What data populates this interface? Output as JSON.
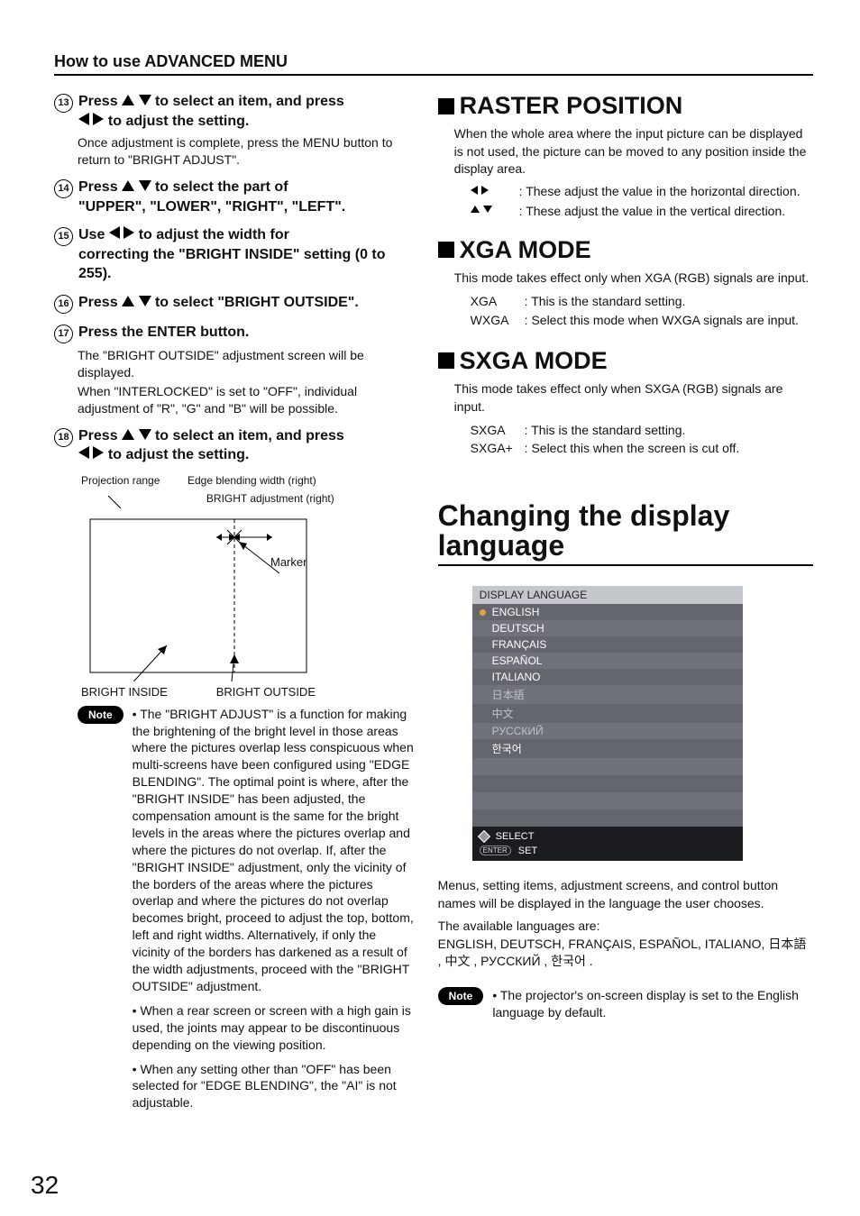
{
  "pageNumber": "32",
  "header": "How to use ADVANCED MENU",
  "left": {
    "step13": {
      "n": "13",
      "textA": "Press",
      "textB": "to select an item, and press",
      "textC": "to adjust the setting.",
      "body": "Once adjustment is complete, press the MENU button to return to \"BRIGHT ADJUST\"."
    },
    "step14": {
      "n": "14",
      "textA": "Press",
      "textB": "to select the part of",
      "textC": "\"UPPER\", \"LOWER\", \"RIGHT\", \"LEFT\"."
    },
    "step15": {
      "n": "15",
      "textA": "Use",
      "textB": "to adjust the width for",
      "textC": "correcting the \"BRIGHT INSIDE\" setting (0 to 255)."
    },
    "step16": {
      "n": "16",
      "textA": "Press",
      "textB": "to select \"BRIGHT OUTSIDE\"."
    },
    "step17": {
      "n": "17",
      "textA": "Press the ENTER button.",
      "body1": "The \"BRIGHT OUTSIDE\" adjustment screen will be displayed.",
      "body2": "When \"INTERLOCKED\" is set to \"OFF\", individual adjustment of \"R\", \"G\" and \"B\" will be possible."
    },
    "step18": {
      "n": "18",
      "textA": "Press",
      "textB": "to select an item, and press",
      "textC": "to adjust the setting."
    },
    "diagram": {
      "projRange": "Projection range",
      "edgeWidth": "Edge blending width (right)",
      "brightAdj": "BRIGHT adjustment (right)",
      "marker": "Marker",
      "inside": "BRIGHT INSIDE",
      "outside": "BRIGHT OUTSIDE"
    },
    "noteLabel": "Note",
    "note1": "• The \"BRIGHT ADJUST\" is a function for making the brightening of the bright level in those areas where the pictures overlap less conspicuous when multi-screens have been configured using \"EDGE BLENDING\". The optimal point is where, after the \"BRIGHT INSIDE\" has been adjusted, the compensation amount is the same for the bright levels in the areas where the pictures overlap and where the pictures do not overlap. If, after the \"BRIGHT INSIDE\" adjustment, only the vicinity of the borders of the areas where the pictures overlap and where the pictures do not overlap becomes bright, proceed to adjust the top, bottom, left and right widths. Alternatively, if only the vicinity of the borders has darkened as a result of the width adjustments, proceed with the \"BRIGHT OUTSIDE\" adjustment.",
    "note2": "• When a rear screen or screen with a high gain is used, the joints may appear to be discontinuous depending on the viewing position.",
    "note3": "• When any setting other than \"OFF\" has been selected for \"EDGE BLENDING\", the \"AI\" is not adjustable."
  },
  "right": {
    "raster": {
      "title": "RASTER POSITION",
      "para": "When the whole area where the input picture can be displayed is not used, the picture can be moved to any position inside the display area.",
      "h": ": These adjust the value in the horizontal direction.",
      "v": ": These adjust the value in the vertical direction."
    },
    "xga": {
      "title": "XGA MODE",
      "para": "This mode takes effect only when XGA (RGB) signals are input.",
      "k1": "XGA",
      "v1": ": This is the standard setting.",
      "k2": "WXGA",
      "v2": ": Select this mode when WXGA signals are input."
    },
    "sxga": {
      "title": "SXGA MODE",
      "para": "This mode takes effect only when SXGA (RGB) signals are input.",
      "k1": "SXGA",
      "v1": ": This is the standard setting.",
      "k2": "SXGA+",
      "v2": ": Select this when the screen is cut off."
    },
    "lang": {
      "title": "Changing the display language",
      "menuHead": "DISPLAY LANGUAGE",
      "items": [
        "ENGLISH",
        "DEUTSCH",
        "FRANÇAIS",
        "ESPAÑOL",
        "ITALIANO",
        "日本語",
        "中文",
        "РУССКИЙ",
        "한국어"
      ],
      "footSelect": "SELECT",
      "footSet": "SET",
      "para1": "Menus, setting items, adjustment screens, and control button names will be displayed in the language the user chooses.",
      "para2": "The available languages are:",
      "para3a": "ENGLISH, DEUTSCH, FRANÇAIS, ESPAÑOL, ITALIANO, ",
      "para3b": "日本語 , 中文 , РУССКИЙ , 한국어",
      "para3c": " .",
      "noteLabel": "Note",
      "note": "• The projector's on-screen display is set to the English language by default."
    }
  }
}
